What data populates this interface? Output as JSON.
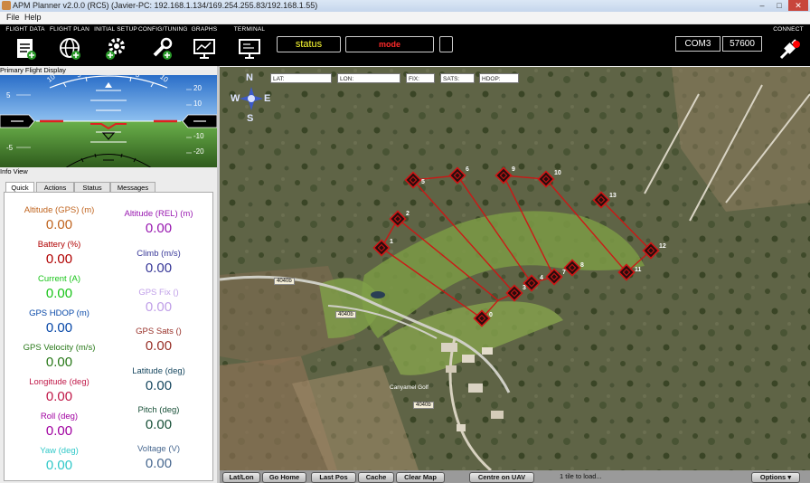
{
  "window": {
    "title": "APM Planner v2.0.0 (RC5) (Javier-PC: 192.168.1.134/169.254.255.83/192.168.1.55)",
    "controls": [
      "–",
      "□",
      "✕"
    ]
  },
  "menu": [
    "File",
    "Help"
  ],
  "toolbar": {
    "buttons": [
      {
        "label": "FLIGHT DATA",
        "icon": "flight-data-icon"
      },
      {
        "label": "FLIGHT PLAN",
        "icon": "globe-icon"
      },
      {
        "label": "INITIAL SETUP",
        "icon": "gear-icon"
      },
      {
        "label": "CONFIG/TUNING",
        "icon": "wrench-icon"
      },
      {
        "label": "GRAPHS",
        "icon": "graph-monitor-icon"
      },
      {
        "label": "TERMINAL",
        "icon": "terminal-icon"
      }
    ],
    "status": "status",
    "mode": "mode",
    "port": "COM3",
    "baud": "57600",
    "connect_label": "CONNECT",
    "colors": {
      "status": "#ffff33",
      "mode": "#ff2a2a",
      "accent": "#ff0000"
    }
  },
  "pfd": {
    "title": "Primary Flight Display",
    "roll_scale": [
      "10",
      "5",
      "5",
      "10"
    ],
    "pitch_left": [
      "5",
      "0",
      "-5"
    ],
    "pitch_right": [
      "20",
      "10",
      "0",
      "-10",
      "-20"
    ],
    "speed": "",
    "altitude": ""
  },
  "info": {
    "title": "Info View",
    "tabs": [
      "Quick",
      "Actions",
      "Status",
      "Messages"
    ],
    "left": [
      {
        "label": "Altitude (GPS) (m)",
        "value": "0.00",
        "color": "#c0641e"
      },
      {
        "label": "Battery (%)",
        "value": "0.00",
        "color": "#b00000"
      },
      {
        "label": "Current (A)",
        "value": "0.00",
        "color": "#18c418"
      },
      {
        "label": "GPS HDOP (m)",
        "value": "0.00",
        "color": "#0848a8"
      },
      {
        "label": "GPS Velocity (m/s)",
        "value": "0.00",
        "color": "#287818"
      },
      {
        "label": "Longitude (deg)",
        "value": "0.00",
        "color": "#c01848"
      },
      {
        "label": "Roll (deg)",
        "value": "0.00",
        "color": "#a000a0"
      },
      {
        "label": "Yaw (deg)",
        "value": "0.00",
        "color": "#30c8c8"
      }
    ],
    "right": [
      {
        "label": "Altitude (REL) (m)",
        "value": "0.00",
        "color": "#9818b0"
      },
      {
        "label": "Climb (m/s)",
        "value": "0.00",
        "color": "#383898"
      },
      {
        "label": "GPS Fix ()",
        "value": "0.00",
        "color": "#c0a0e8"
      },
      {
        "label": "GPS Sats ()",
        "value": "0.00",
        "color": "#983028"
      },
      {
        "label": "Latitude (deg)",
        "value": "0.00",
        "color": "#184860"
      },
      {
        "label": "Pitch (deg)",
        "value": "0.00",
        "color": "#185038"
      },
      {
        "label": "Voltage (V)",
        "value": "0.00",
        "color": "#486890"
      }
    ]
  },
  "map": {
    "compass": {
      "n": "N",
      "s": "S",
      "e": "E",
      "w": "W"
    },
    "fields": [
      {
        "label": "LAT:"
      },
      {
        "label": "LON:"
      },
      {
        "label": "FIX:"
      },
      {
        "label": "SATS:"
      },
      {
        "label": "HDOP:"
      }
    ],
    "waypoints": [
      "0",
      "1",
      "2",
      "3",
      "4",
      "5",
      "6",
      "7",
      "8",
      "9",
      "10",
      "11",
      "12",
      "13"
    ],
    "road_labels": [
      "4040b",
      "4040b",
      "4040b"
    ],
    "place_label": "Canyamel Golf",
    "route_color": "#d01414"
  },
  "bottom": {
    "buttons": [
      "Lat/Lon",
      "Go Home",
      "Last Pos",
      "Cache",
      "Clear Map",
      "Centre on UAV"
    ],
    "status": "1 tile to load...",
    "options": "Options"
  }
}
